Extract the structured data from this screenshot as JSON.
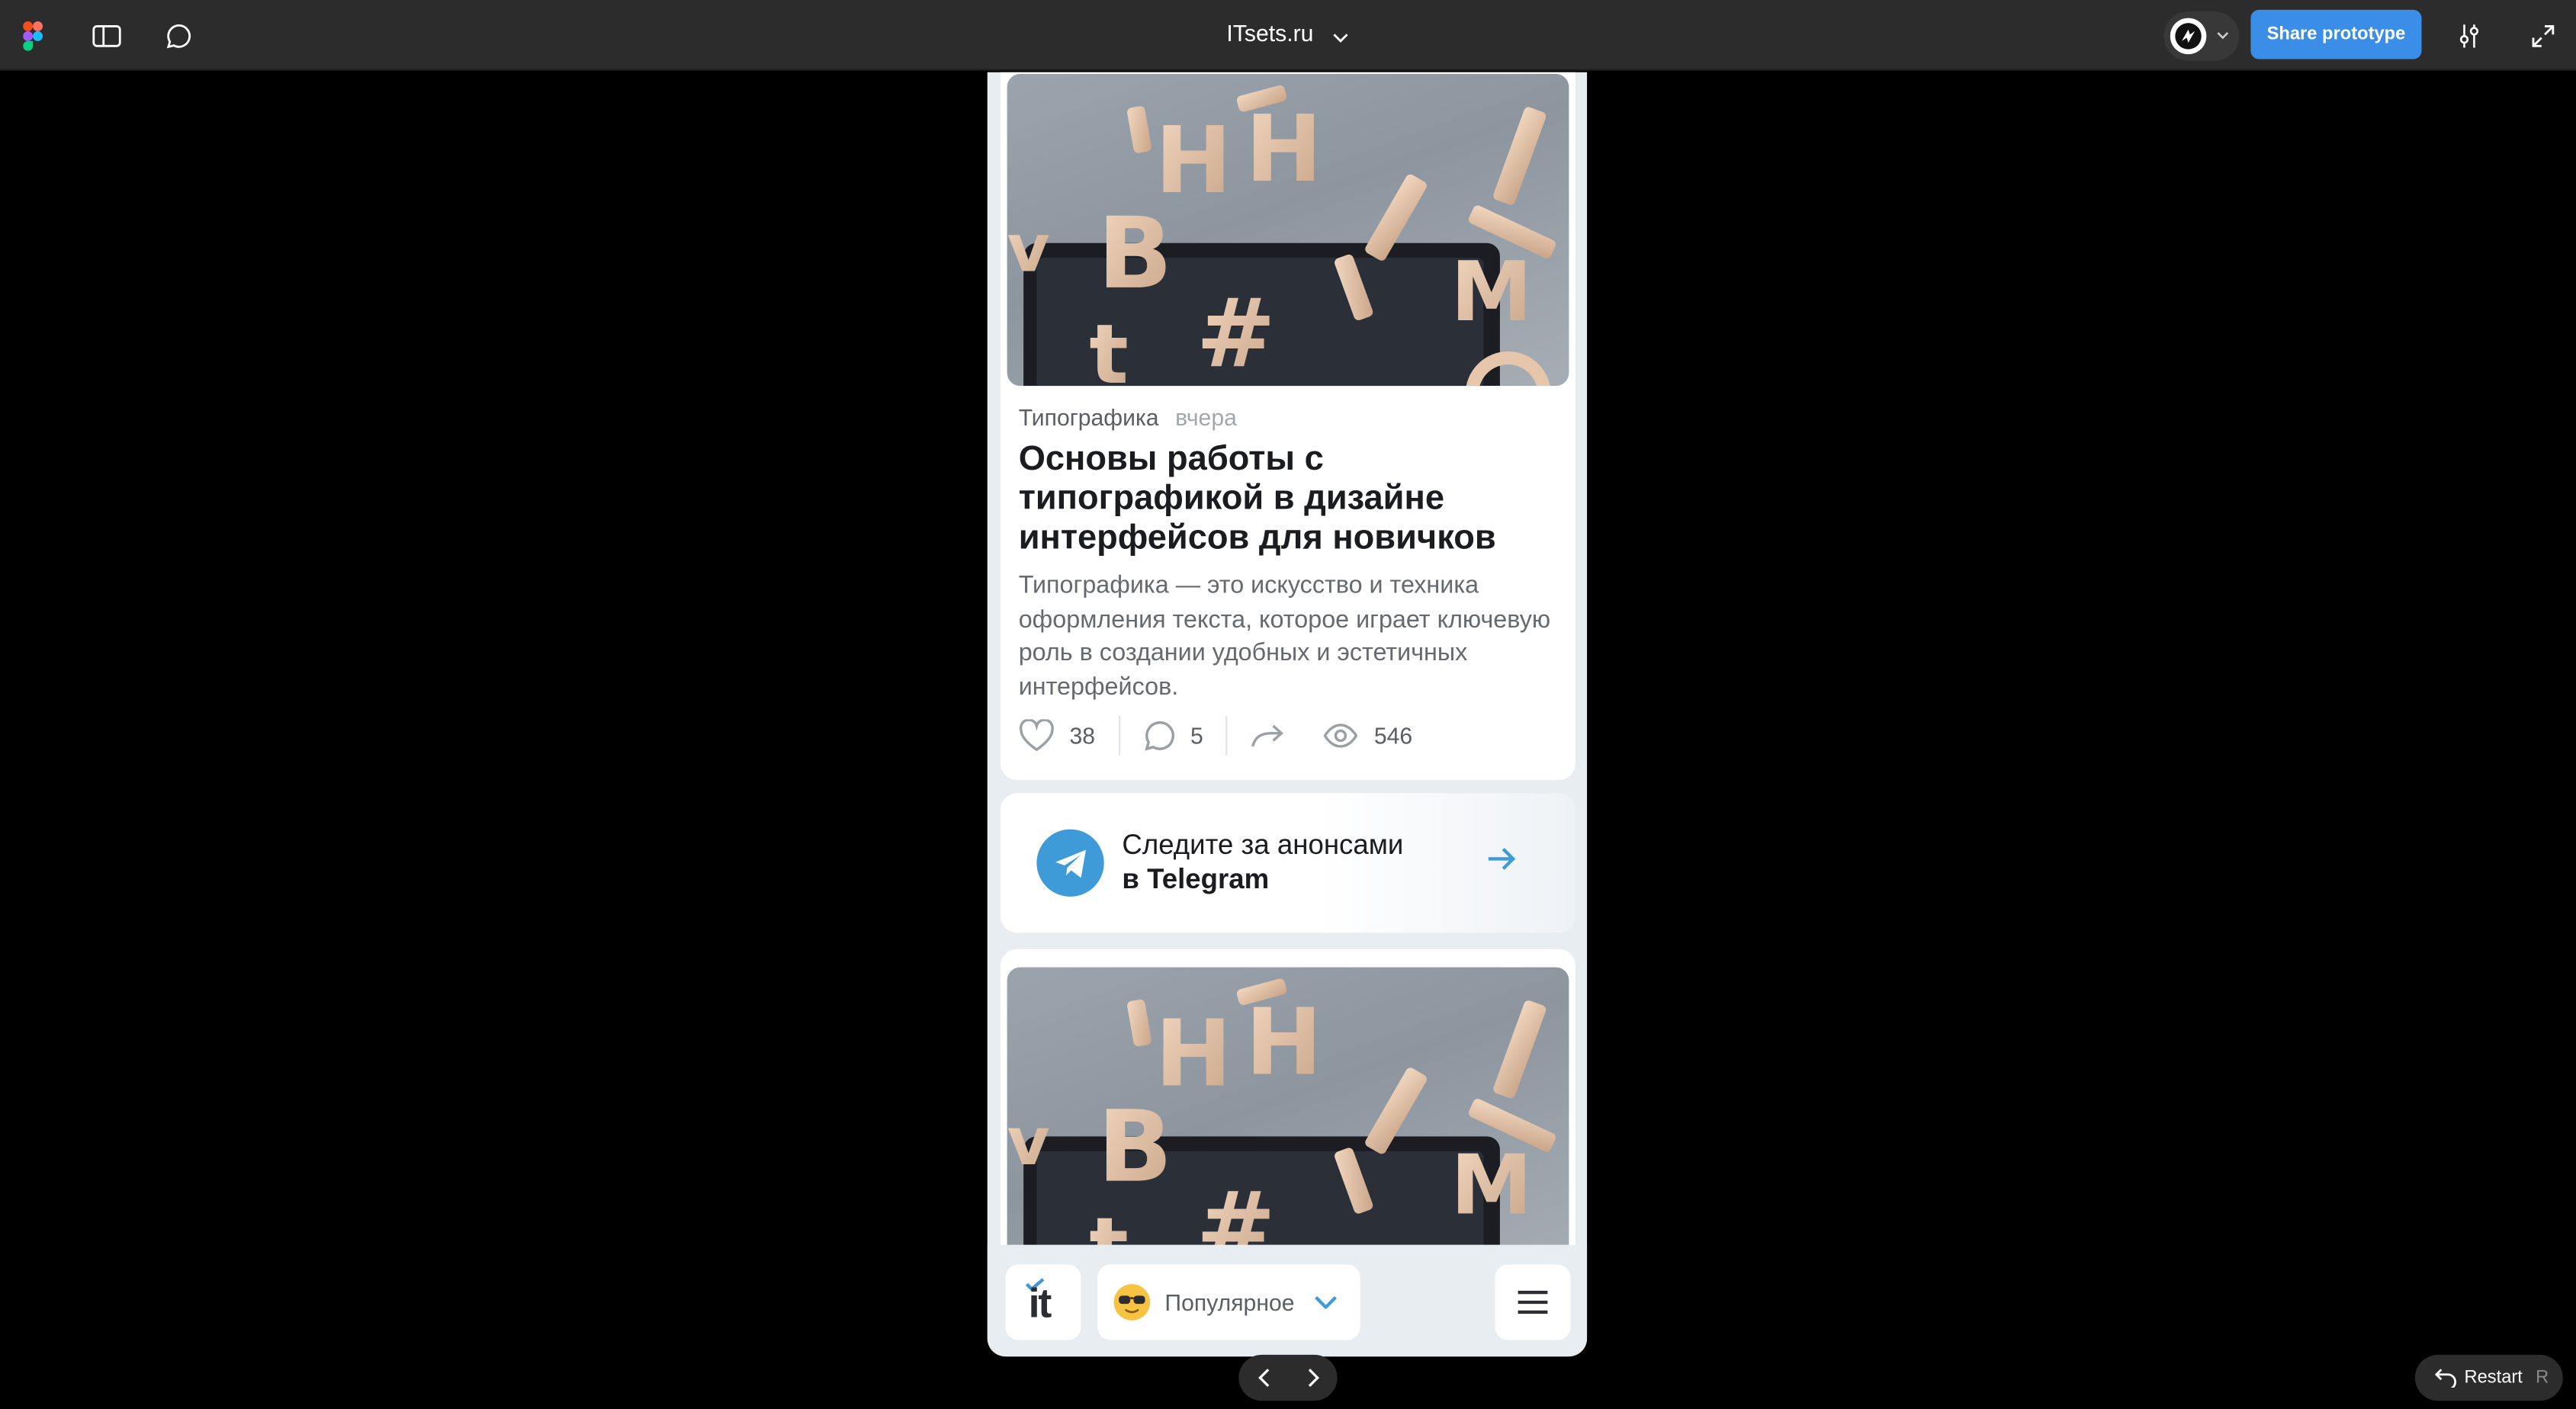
{
  "figma": {
    "file_title": "ITsets.ru",
    "share_label": "Share prototype",
    "restart_label": "Restart",
    "restart_key": "R"
  },
  "article": {
    "category": "Типографика",
    "date": "вчера",
    "title": "Основы работы с типографикой в дизайне интерфейсов для новичков",
    "description": "Типографика — это искусство и техника оформления текста, которое играет ключевую роль в создании удобных и эстетичных интерфейсов.",
    "likes": "38",
    "comments": "5",
    "views": "546",
    "image_icon": "typography-letters-image"
  },
  "telegram_banner": {
    "line1": "Следите за анонсами",
    "line2": "в Telegram",
    "accent": "#3f9ad8"
  },
  "bottom_nav": {
    "logo_text": "it",
    "filter_label": "Популярное",
    "filter_emoji": "sunglasses-emoji"
  },
  "colors": {
    "share_button": "#3b8ee8",
    "figma_bar": "#2c2c2c",
    "phone_bg": "#e8edf2"
  }
}
